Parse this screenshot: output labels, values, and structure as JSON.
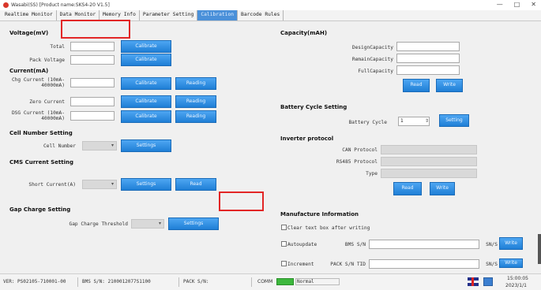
{
  "window": {
    "title": "Wasabi(SS)  [Product name:SKS4-20 V1.5]",
    "minimize": "—",
    "maximize": "□",
    "close": "✕"
  },
  "tabs": [
    {
      "label": "Realtime Monitor",
      "active": false
    },
    {
      "label": "Data Monitor",
      "active": false
    },
    {
      "label": "Memory Info",
      "active": false
    },
    {
      "label": "Parameter Setting",
      "active": false
    },
    {
      "label": "Calibration",
      "active": true
    },
    {
      "label": "Barcode Rules",
      "active": false
    }
  ],
  "voltage": {
    "title": "Voltage(mV)",
    "total_label": "Total",
    "pack_label": "Pack Voltage",
    "calibrate_btn": "Calibrate",
    "calibrate_btn2": "Calibrate"
  },
  "current": {
    "title": "Current(mA)",
    "chg_label": "Chg Current (10mA-40000mA)",
    "zero_label": "Zero Current",
    "dsg_label": "DSG Current (10mA-40000mA)",
    "calibrate": "Calibrate",
    "reading": "Reading"
  },
  "cell_number": {
    "title": "Cell Number Setting",
    "label": "Cell Number",
    "btn": "Settings"
  },
  "cms_current": {
    "title": "CMS Current Setting",
    "label": "Short Current(A)",
    "btn1": "Settings",
    "btn2": "Read"
  },
  "gap_charge": {
    "title": "Gap Charge Setting",
    "label": "Gap Charge Threshold",
    "btn": "Settings"
  },
  "capacity": {
    "title": "Capacity(mAH)",
    "design_label": "DesignCapacity",
    "remain_label": "RemainCapacity",
    "full_label": "FullCapacity",
    "read_btn": "Read",
    "write_btn": "Write"
  },
  "battery_cycle": {
    "title": "Battery Cycle Setting",
    "label": "Battery Cycle",
    "value": "1",
    "btn": "Setting"
  },
  "inverter": {
    "title": "Inverter protocol",
    "can_label": "CAN Protocol",
    "rs485_label": "RS485 Protocol",
    "type_label": "Type",
    "read_btn": "Read",
    "write_btn": "Write"
  },
  "manufacture": {
    "title": "Manufacture Information",
    "clear_label": "Clear text box after writing",
    "autoupdate_label": "Autoupdate",
    "bms_sn_label": "BMS S/N",
    "increment_label": "Increment",
    "pack_sn_label": "PACK S/N TID",
    "len_label": "SN/S",
    "write_btn": "Write"
  },
  "status": {
    "ver": "VER: PS02105-710001-00",
    "bms": "BMS S/N: 2100012077S1100",
    "pack": "PACK S/N:",
    "comm": "COMM",
    "normal": "Normal",
    "time": "15:00:05",
    "date": "2023/1/1"
  }
}
